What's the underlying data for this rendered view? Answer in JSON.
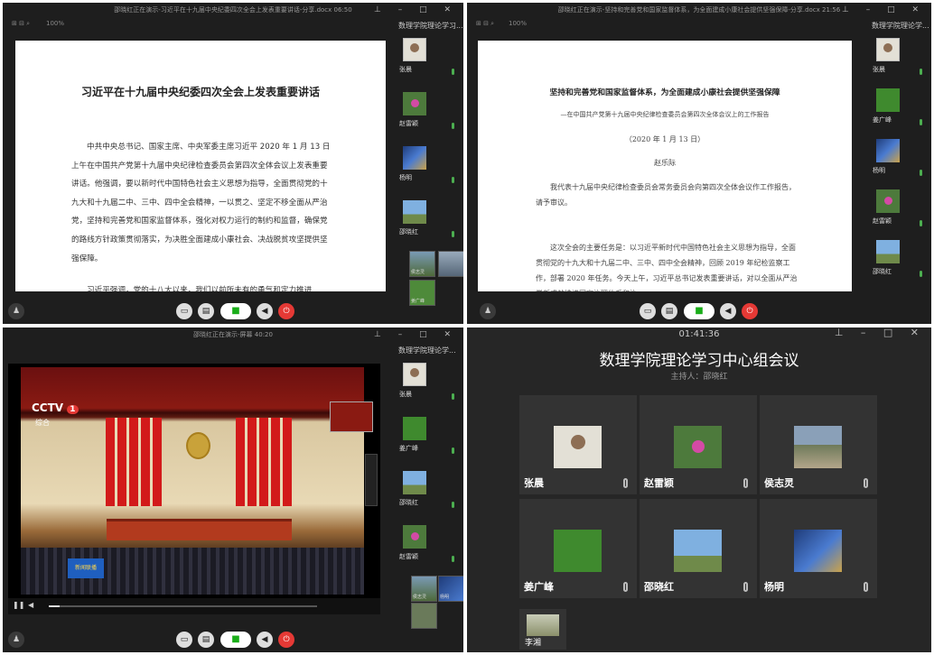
{
  "q1": {
    "title": "邵晓红正在演示-习近平在十九届中央纪委四次全会上发表重要讲话-分享.docx 06:50",
    "zoom": "100%",
    "doc_title": "习近平在十九届中央纪委四次全会上发表重要讲话",
    "doc_para1": "中共中央总书记、国家主席、中央军委主席习近平 2020 年 1 月 13 日上午在中国共产党第十九届中央纪律检查委员会第四次全体会议上发表重要讲话。他强调，要以新时代中国特色社会主义思想为指导，全面贯彻党的十九大和十九届二中、三中、四中全会精神，一以贯之、坚定不移全面从严治党，坚持和完善党和国家监督体系，强化对权力运行的制约和监督，确保党的路线方针政策贯彻落实，为决胜全面建成小康社会、决战脱贫攻坚提供坚强保障。",
    "doc_para2": "习近平强调，党的十八大以来，我们以前所未有的勇气和定力推进",
    "side_title": "数理学院理论学习...",
    "participants": [
      "张晨",
      "赵雷颖",
      "杨明",
      "邵晓红"
    ],
    "small": [
      "侯志灵",
      "姜广峰"
    ]
  },
  "q2": {
    "title": "邵晓红正在演示-坚持和完善党和国家监督体系，为全面建成小康社会提供坚强保障-分享.docx 21:56",
    "zoom": "100%",
    "doc_title": "坚持和完善党和国家监督体系，为全面建成小康社会提供坚强保障",
    "doc_sub": "—在中国共产党第十九届中央纪律检查委员会第四次全体会议上的工作报告",
    "doc_date": "（2020 年 1 月 13 日）",
    "doc_author": "赵乐际",
    "doc_para1": "我代表十九届中央纪律检查委员会常务委员会向第四次全体会议作工作报告，请予审议。",
    "doc_para2": "这次全会的主要任务是：以习近平新时代中国特色社会主义思想为指导，全面贯彻党的十九大和十九届二中、三中、四中全会精神，回顾 2019 年纪检监察工作，部署 2020 年任务。今天上午，习近平总书记发表重要讲话，对以全面从严治党新成效推进国家治理体系和治",
    "side_title": "数理学院理论学...",
    "participants": [
      "张晨",
      "姜广峰",
      "杨明",
      "赵雷颖",
      "邵晓红"
    ]
  },
  "q3": {
    "title": "邵晓红正在演示-屏幕 40:20",
    "side_title": "数理学院理论学...",
    "cctv": "CCTV",
    "cctv_num": "1",
    "cctv_sub": "综合",
    "news_logo": "新闻联播",
    "participants": [
      "张晨",
      "姜广峰",
      "邵晓红",
      "赵雷颖"
    ],
    "small": [
      "侯志灵",
      "杨明"
    ]
  },
  "q4": {
    "timer": "01:41:36",
    "meeting_title": "数理学院理论学习中心组会议",
    "host_label": "主持人：邵晓红",
    "participants": [
      "张晨",
      "赵雷颖",
      "侯志灵",
      "姜广峰",
      "邵晓红",
      "杨明"
    ],
    "last": "李湘"
  },
  "icons": {
    "people": "people-icon",
    "share": "screen-share-icon",
    "folder": "folder-icon",
    "video": "video-icon",
    "speaker": "speaker-icon",
    "leave": "leave-icon"
  },
  "colors": {
    "accent_green": "#1aad19",
    "leave_red": "#e53935",
    "mic_green": "#4caf50"
  }
}
